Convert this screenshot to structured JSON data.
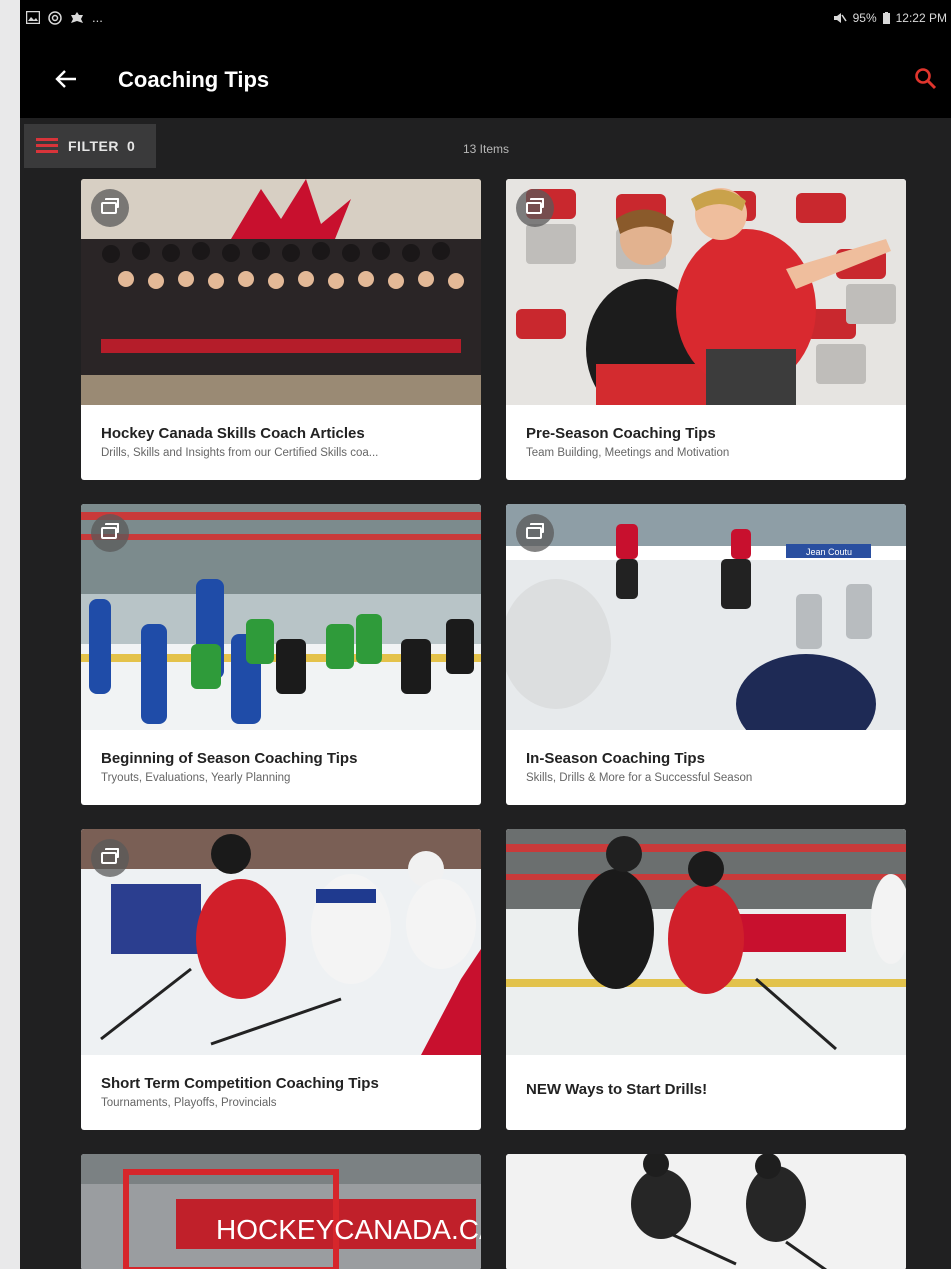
{
  "status_bar": {
    "left_icons": [
      "image-icon",
      "instagram-icon",
      "game-icon"
    ],
    "more": "...",
    "battery": "95%",
    "time": "12:22 PM"
  },
  "app_bar": {
    "title": "Coaching Tips",
    "back_icon": "arrow-left-icon",
    "search_icon": "search-icon"
  },
  "filter_bar": {
    "label": "FILTER",
    "count": "0",
    "items_count": "13 Items"
  },
  "cards": [
    {
      "title": "Hockey Canada Skills Coach Articles",
      "subtitle": "Drills, Skills and Insights from our Certified Skills coa...",
      "has_collection_badge": true
    },
    {
      "title": "Pre-Season Coaching Tips",
      "subtitle": "Team Building, Meetings and Motivation",
      "has_collection_badge": true
    },
    {
      "title": "Beginning of Season Coaching Tips",
      "subtitle": "Tryouts, Evaluations, Yearly Planning",
      "has_collection_badge": true
    },
    {
      "title": "In-Season Coaching Tips",
      "subtitle": "Skills, Drills & More for a Successful Season",
      "has_collection_badge": true
    },
    {
      "title": "Short Term Competition Coaching Tips",
      "subtitle": "Tournaments, Playoffs, Provincials",
      "has_collection_badge": true
    },
    {
      "title": "NEW Ways to Start Drills!",
      "subtitle": "",
      "has_collection_badge": false
    },
    {
      "title": "",
      "subtitle": "",
      "image_text": "HOCKEYCANADA.CA",
      "has_collection_badge": false
    },
    {
      "title": "",
      "subtitle": "",
      "has_collection_badge": false
    }
  ],
  "image_texts": {
    "card6_banner": "HOCKEYCANADA.CA",
    "card4_banner": "Jean Coutu"
  },
  "colors": {
    "accent": "#c8102e",
    "background": "#202021",
    "appbar": "#000000",
    "card": "#ffffff"
  }
}
